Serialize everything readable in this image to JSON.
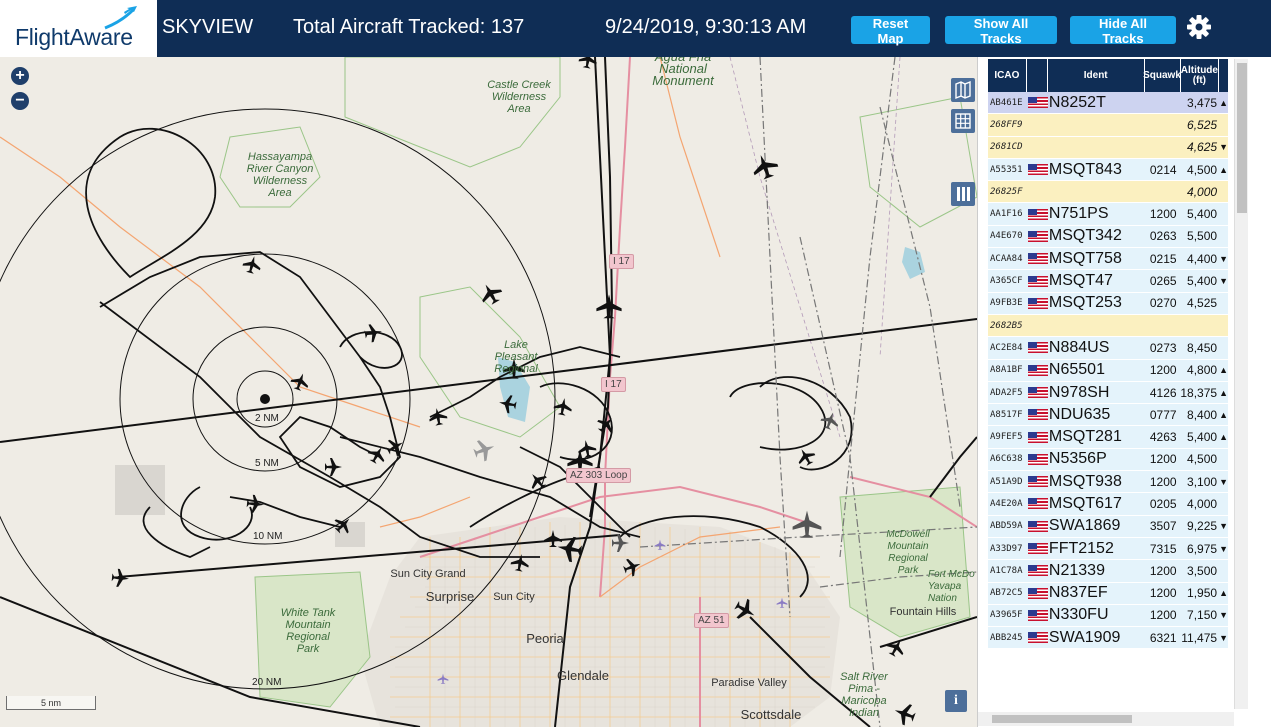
{
  "header": {
    "brand": "FlightAware",
    "app_name": "SKYVIEW",
    "total_tracked": "Total Aircraft Tracked: 137",
    "datetime": "9/24/2019, 9:30:13 AM",
    "reset_label": "Reset Map",
    "show_label": "Show All Tracks",
    "hide_label": "Hide All Tracks",
    "accent_color": "#1aa3e6",
    "bar_color": "#0f2d55"
  },
  "map": {
    "zoom_in": "+",
    "zoom_out": "−",
    "rings": [
      "2 NM",
      "5 NM",
      "10 NM",
      "20 NM"
    ],
    "scale": "5 nm",
    "info": "i",
    "labels": {
      "castle_creek": "Castle Creek\nWilderness\nArea",
      "agua_fria": "Agua Fria\nNational\nMonument",
      "hassayampa": "Hassayampa\nRiver Canyon\nWilderness\nArea",
      "lake_pleasant": "Lake Pleasant\nRegional",
      "white_tank": "White Tank\nMountain\nRegional\nPark",
      "mcdowell": "McDowell\nMountain\nRegional\nPark",
      "fort_mcdowell": "Fort McDo\nYavapa\nNation",
      "salt_river": "Salt River\nPima -\nMaricopa\nIndian",
      "sun_city_grand": "Sun City Grand",
      "surprise": "Surprise",
      "sun_city": "Sun City",
      "peoria": "Peoria",
      "glendale": "Glendale",
      "paradise_valley": "Paradise Valley",
      "scottsdale": "Scottsdale",
      "fountain_hills": "Fountain Hills"
    },
    "shields": {
      "i17_north": "I 17",
      "i17_south": "I 17",
      "loop303": "AZ 303 Loop",
      "az51": "AZ 51"
    }
  },
  "table": {
    "headers": {
      "icao": "ICAO",
      "ident": "Ident",
      "squawk": "Squawk",
      "altitude": "Altitude\n(ft)"
    },
    "rows": [
      {
        "icao": "AB461E",
        "flag": true,
        "ident": "N8252T",
        "squawk": "",
        "alt": "3,475",
        "arrow": "▲",
        "style": "sel"
      },
      {
        "icao": "268FF9",
        "flag": false,
        "ident": "",
        "squawk": "",
        "alt": "6,525",
        "arrow": "",
        "style": "yellow"
      },
      {
        "icao": "2681CD",
        "flag": false,
        "ident": "",
        "squawk": "",
        "alt": "4,625",
        "arrow": "▼",
        "style": "yellow"
      },
      {
        "icao": "A55351",
        "flag": true,
        "ident": "MSQT843",
        "squawk": "0214",
        "alt": "4,500",
        "arrow": "▲",
        "style": "blue"
      },
      {
        "icao": "26825F",
        "flag": false,
        "ident": "",
        "squawk": "",
        "alt": "4,000",
        "arrow": "",
        "style": "yellow"
      },
      {
        "icao": "AA1F16",
        "flag": true,
        "ident": "N751PS",
        "squawk": "1200",
        "alt": "5,400",
        "arrow": "",
        "style": "blue"
      },
      {
        "icao": "A4E670",
        "flag": true,
        "ident": "MSQT342",
        "squawk": "0263",
        "alt": "5,500",
        "arrow": "",
        "style": "blue"
      },
      {
        "icao": "ACAA84",
        "flag": true,
        "ident": "MSQT758",
        "squawk": "0215",
        "alt": "4,400",
        "arrow": "▼",
        "style": "blue"
      },
      {
        "icao": "A365CF",
        "flag": true,
        "ident": "MSQT47",
        "squawk": "0265",
        "alt": "5,400",
        "arrow": "▼",
        "style": "blue"
      },
      {
        "icao": "A9FB3E",
        "flag": true,
        "ident": "MSQT253",
        "squawk": "0270",
        "alt": "4,525",
        "arrow": "",
        "style": "blue"
      },
      {
        "icao": "2682B5",
        "flag": false,
        "ident": "",
        "squawk": "",
        "alt": "",
        "arrow": "",
        "style": "yellow"
      },
      {
        "icao": "AC2E84",
        "flag": true,
        "ident": "N884US",
        "squawk": "0273",
        "alt": "8,450",
        "arrow": "",
        "style": "blue"
      },
      {
        "icao": "A8A1BF",
        "flag": true,
        "ident": "N65501",
        "squawk": "1200",
        "alt": "4,800",
        "arrow": "▲",
        "style": "blue"
      },
      {
        "icao": "ADA2F5",
        "flag": true,
        "ident": "N978SH",
        "squawk": "4126",
        "alt": "18,375",
        "arrow": "▲",
        "style": "blue"
      },
      {
        "icao": "A8517F",
        "flag": true,
        "ident": "NDU635",
        "squawk": "0777",
        "alt": "8,400",
        "arrow": "▲",
        "style": "blue"
      },
      {
        "icao": "A9FEF5",
        "flag": true,
        "ident": "MSQT281",
        "squawk": "4263",
        "alt": "5,400",
        "arrow": "▲",
        "style": "blue"
      },
      {
        "icao": "A6C638",
        "flag": true,
        "ident": "N5356P",
        "squawk": "1200",
        "alt": "4,500",
        "arrow": "",
        "style": "blue"
      },
      {
        "icao": "A51A9D",
        "flag": true,
        "ident": "MSQT938",
        "squawk": "1200",
        "alt": "3,100",
        "arrow": "▼",
        "style": "blue"
      },
      {
        "icao": "A4E20A",
        "flag": true,
        "ident": "MSQT617",
        "squawk": "0205",
        "alt": "4,000",
        "arrow": "",
        "style": "blue"
      },
      {
        "icao": "ABD59A",
        "flag": true,
        "ident": "SWA1869",
        "squawk": "3507",
        "alt": "9,225",
        "arrow": "▼",
        "style": "blue"
      },
      {
        "icao": "A33D97",
        "flag": true,
        "ident": "FFT2152",
        "squawk": "7315",
        "alt": "6,975",
        "arrow": "▼",
        "style": "blue"
      },
      {
        "icao": "A1C78A",
        "flag": true,
        "ident": "N21339",
        "squawk": "1200",
        "alt": "3,500",
        "arrow": "",
        "style": "blue"
      },
      {
        "icao": "AB72C5",
        "flag": true,
        "ident": "N837EF",
        "squawk": "1200",
        "alt": "1,950",
        "arrow": "▲",
        "style": "blue"
      },
      {
        "icao": "A3965F",
        "flag": true,
        "ident": "N330FU",
        "squawk": "1200",
        "alt": "7,150",
        "arrow": "▼",
        "style": "blue"
      },
      {
        "icao": "ABB245",
        "flag": true,
        "ident": "SWA1909",
        "squawk": "6321",
        "alt": "11,475",
        "arrow": "▼",
        "style": "blue"
      }
    ]
  }
}
